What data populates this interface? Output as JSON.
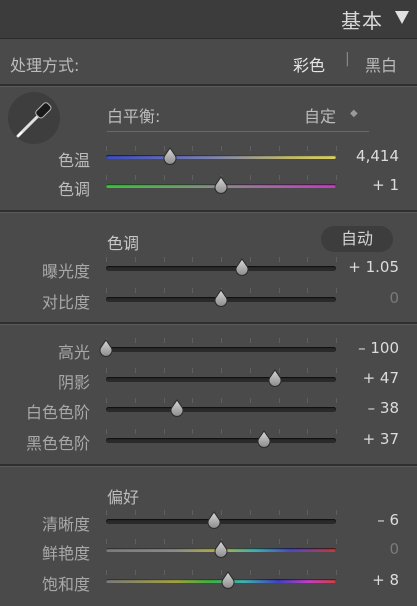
{
  "header": {
    "title": "基本"
  },
  "treatment": {
    "label": "处理方式:",
    "color": "彩色",
    "separator": "|",
    "bw": "黑白"
  },
  "white_balance": {
    "label": "白平衡:",
    "value": "自定",
    "arrows": "◆"
  },
  "tone_section": {
    "title": "色调",
    "auto": "自动"
  },
  "presence_section": {
    "title": "偏好"
  },
  "sliders": {
    "temp": {
      "label": "色温",
      "value": "4,414",
      "position": 0.28,
      "gradient": "linear-gradient(90deg,#3a4cc0,#7a7fb0 45%,#c0b86a 80%,#d8d060)"
    },
    "tint": {
      "label": "色调",
      "value": "+ 1",
      "position": 0.5,
      "gradient": "linear-gradient(90deg,#3cc03c,#8a8a8a 50%,#c03cc0)"
    },
    "exposure": {
      "label": "曝光度",
      "value": "+ 1.05",
      "position": 0.59
    },
    "contrast": {
      "label": "对比度",
      "value": "0",
      "position": 0.5
    },
    "highlights": {
      "label": "高光",
      "value": "– 100",
      "position": 0.0
    },
    "shadows": {
      "label": "阴影",
      "value": "+ 47",
      "position": 0.735
    },
    "whites": {
      "label": "白色色阶",
      "value": "– 38",
      "position": 0.31
    },
    "blacks": {
      "label": "黑色色阶",
      "value": "+ 37",
      "position": 0.685
    },
    "clarity": {
      "label": "清晰度",
      "value": "– 6",
      "position": 0.47
    },
    "vibrance": {
      "label": "鲜艳度",
      "value": "0",
      "position": 0.5,
      "gradient": "linear-gradient(90deg,#7a7a7a,#8a8a8a 30%,#b0b04a 50%,#3ab0b0 65%,#4a4ac0 80%,#c03a3a)"
    },
    "saturation": {
      "label": "饱和度",
      "value": "+ 8",
      "position": 0.53,
      "gradient": "linear-gradient(90deg,#7a7a7a,#a0a040 30%,#40b040 45%,#40b0b0 60%,#4040c0 75%,#c040c0 88%,#d04040)"
    }
  }
}
